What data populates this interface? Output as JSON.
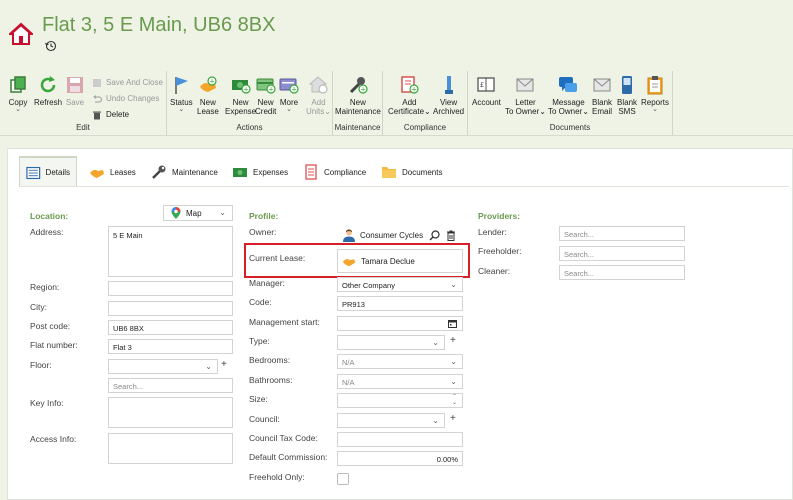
{
  "title": "Flat 3, 5 E Main, UB6 8BX",
  "ribbon": {
    "edit": {
      "label": "Edit",
      "copy": "Copy",
      "refresh": "Refresh",
      "save": "Save",
      "save_and_close": "Save And Close",
      "undo_changes": "Undo Changes",
      "delete": "Delete"
    },
    "actions": {
      "label": "Actions",
      "status": "Status",
      "new_lease": [
        "New",
        "Lease"
      ],
      "new_expense": [
        "New",
        "Expense"
      ],
      "new_credit": [
        "New",
        "Credit"
      ],
      "more": "More",
      "add_units": [
        "Add",
        "Units"
      ]
    },
    "maintenance": {
      "label": "Maintenance",
      "new_maintenance": [
        "New",
        "Maintenance"
      ]
    },
    "compliance": {
      "label": "Compliance",
      "add_certificate": [
        "Add",
        "Certificate"
      ],
      "view_archived": [
        "View",
        "Archived"
      ]
    },
    "documents": {
      "label": "Documents",
      "account": "Account",
      "letter_to_owner": [
        "Letter",
        "To Owner"
      ],
      "message_to_owner": [
        "Message",
        "To Owner"
      ],
      "blank_email": [
        "Blank",
        "Email"
      ],
      "blank_sms": [
        "Blank",
        "SMS"
      ],
      "reports": "Reports"
    }
  },
  "tabs": [
    "Details",
    "Leases",
    "Maintenance",
    "Expenses",
    "Compliance",
    "Documents"
  ],
  "location": {
    "section": "Location:",
    "map_button": "Map",
    "address_label": "Address:",
    "address_value": "5 E Main",
    "region_label": "Region:",
    "city_label": "City:",
    "postcode_label": "Post code:",
    "postcode_value": "UB6 8BX",
    "flat_number_label": "Flat number:",
    "flat_number_value": "Flat 3",
    "floor_label": "Floor:",
    "search_placeholder": "Search...",
    "key_info_label": "Key Info:",
    "access_info_label": "Access Info:"
  },
  "profile": {
    "section": "Profile:",
    "owner_label": "Owner:",
    "owner_value": "Consumer Cycles",
    "current_lease_label": "Current Lease:",
    "current_lease_value": "Tamara Declue",
    "manager_label": "Manager:",
    "manager_value": "Other Company",
    "code_label": "Code:",
    "code_value": "PR913",
    "management_start_label": "Management start:",
    "type_label": "Type:",
    "bedrooms_label": "Bedrooms:",
    "bedrooms_value": "N/A",
    "bathrooms_label": "Bathrooms:",
    "bathrooms_value": "N/A",
    "size_label": "Size:",
    "council_label": "Council:",
    "council_tax_code_label": "Council Tax Code:",
    "default_commission_label": "Default Commission:",
    "default_commission_value": "0.00%",
    "freehold_only_label": "Freehold Only:"
  },
  "providers": {
    "section": "Providers:",
    "lender_label": "Lender:",
    "freeholder_label": "Freeholder:",
    "cleaner_label": "Cleaner:",
    "search_placeholder": "Search..."
  },
  "colors": {
    "accent_green": "#6a9a4e",
    "highlight_red": "#d61f26",
    "background": "#eef3e6"
  }
}
